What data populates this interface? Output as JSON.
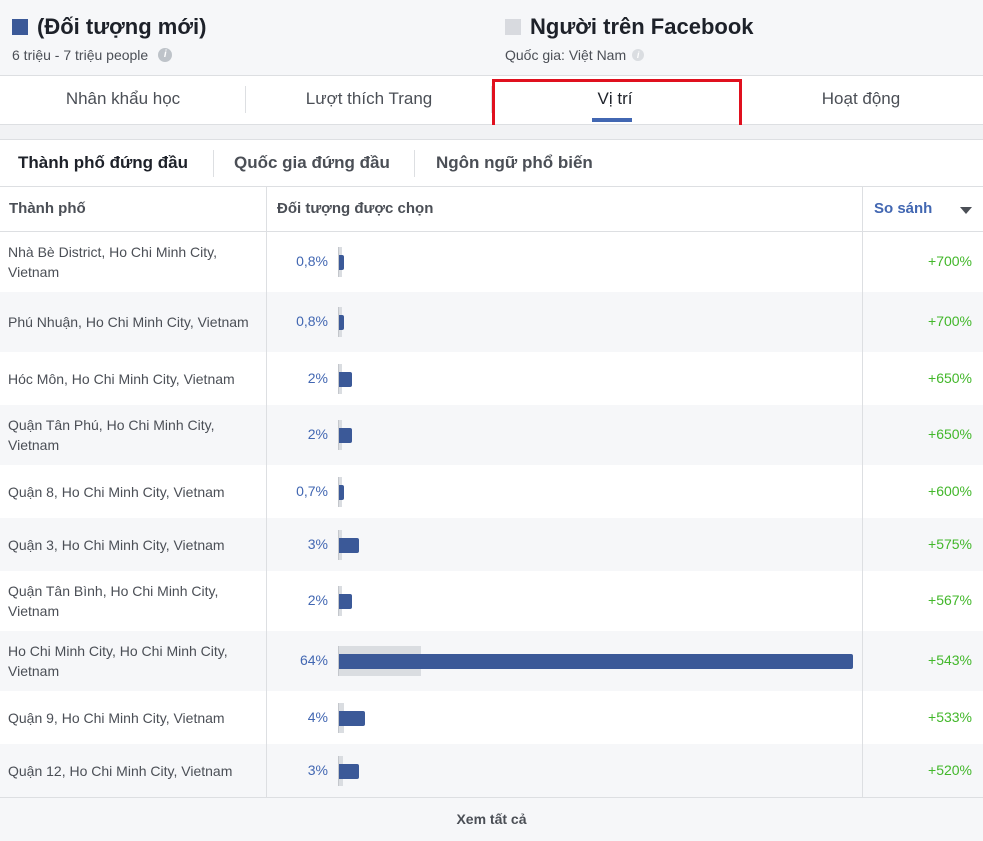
{
  "colors": {
    "audience_a": "#3b5998",
    "audience_b": "#d8dadf",
    "accent": "#4267b2",
    "positive": "#42b72a",
    "highlight": "#e0101e"
  },
  "audience_a": {
    "title": "(Đối tượng mới)",
    "subtitle": "6 triệu - 7 triệu people",
    "info_icon": "info-icon"
  },
  "audience_b": {
    "title": "Người trên Facebook",
    "subtitle": "Quốc gia: Việt Nam",
    "info_icon": "info-icon"
  },
  "tabs": [
    {
      "label": "Nhân khẩu học"
    },
    {
      "label": "Lượt thích Trang"
    },
    {
      "label": "Vị trí",
      "active": true
    },
    {
      "label": "Hoạt động"
    }
  ],
  "subtabs": [
    {
      "label": "Thành phố đứng đầu",
      "active": true
    },
    {
      "label": "Quốc gia đứng đầu"
    },
    {
      "label": "Ngôn ngữ phổ biến"
    }
  ],
  "table": {
    "columns": {
      "city": "Thành phố",
      "audience": "Đối tượng được chọn",
      "compare": "So sánh"
    },
    "rows": [
      {
        "city": "Nhà Bè District, Ho Chi Minh City, Vietnam",
        "pct": "0,8%",
        "value": 0.8,
        "benchmark": 0.1,
        "compare": "+700%"
      },
      {
        "city": "Phú Nhuận, Ho Chi Minh City, Vietnam",
        "pct": "0,8%",
        "value": 0.8,
        "benchmark": 0.1,
        "compare": "+700%"
      },
      {
        "city": "Hóc Môn, Ho Chi Minh City, Vietnam",
        "pct": "2%",
        "value": 2,
        "benchmark": 0.3,
        "compare": "+650%"
      },
      {
        "city": "Quận Tân Phú, Ho Chi Minh City, Vietnam",
        "pct": "2%",
        "value": 2,
        "benchmark": 0.3,
        "compare": "+650%"
      },
      {
        "city": "Quận 8, Ho Chi Minh City, Vietnam",
        "pct": "0,7%",
        "value": 0.7,
        "benchmark": 0.1,
        "compare": "+600%"
      },
      {
        "city": "Quận 3, Ho Chi Minh City, Vietnam",
        "pct": "3%",
        "value": 3,
        "benchmark": 0.4,
        "compare": "+575%"
      },
      {
        "city": "Quận Tân Bình, Ho Chi Minh City, Vietnam",
        "pct": "2%",
        "value": 2,
        "benchmark": 0.4,
        "compare": "+567%"
      },
      {
        "city": "Ho Chi Minh City, Ho Chi Minh City, Vietnam",
        "pct": "64%",
        "value": 64,
        "benchmark": 10,
        "compare": "+543%"
      },
      {
        "city": "Quận 9, Ho Chi Minh City, Vietnam",
        "pct": "4%",
        "value": 4,
        "benchmark": 0.6,
        "compare": "+533%"
      },
      {
        "city": "Quận 12, Ho Chi Minh City, Vietnam",
        "pct": "3%",
        "value": 3,
        "benchmark": 0.5,
        "compare": "+520%"
      }
    ]
  },
  "footer": {
    "see_all": "Xem tất cả"
  }
}
